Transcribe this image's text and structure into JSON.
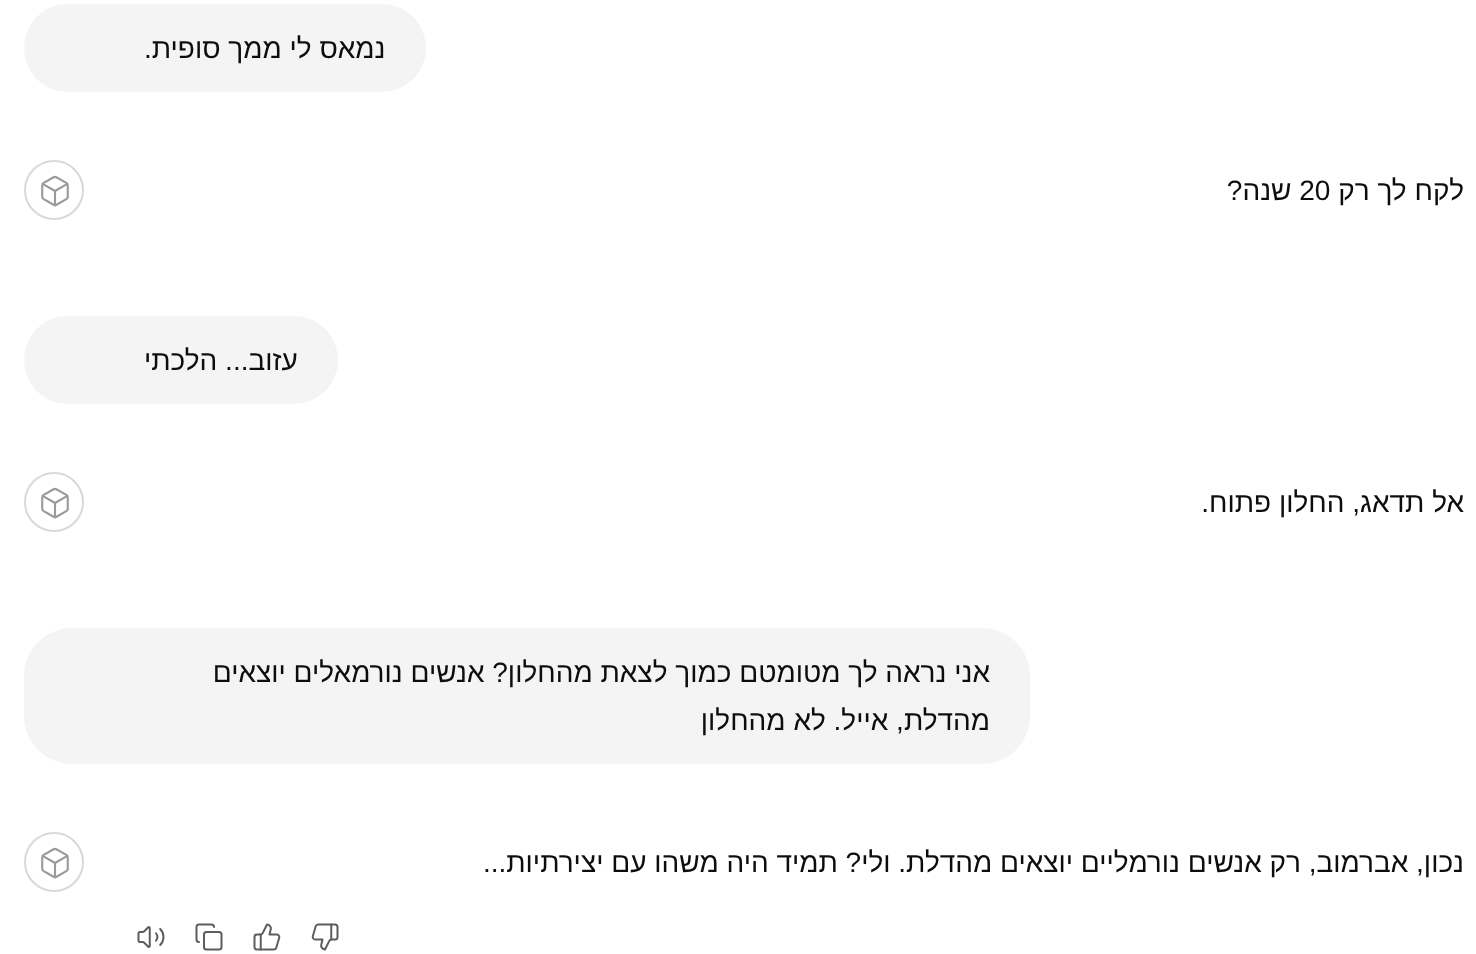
{
  "messages": [
    {
      "kind": "user",
      "text": "נמאס לי ממך סופית."
    },
    {
      "kind": "assistant",
      "text": "לקח לך רק 20 שנה?"
    },
    {
      "kind": "user",
      "text": "עזוב... הלכתי"
    },
    {
      "kind": "assistant",
      "text": "אל תדאג, החלון פתוח."
    },
    {
      "kind": "user",
      "text": "אני נראה לך מטומטם כמוך לצאת מהחלון? אנשים נורמאלים יוצאים מהדלת, אייל. לא מהחלון"
    },
    {
      "kind": "assistant",
      "text": "נכון, אברמוב, רק אנשים נורמליים יוצאים מהדלת. ולי? תמיד היה משהו עם יצירתיות...",
      "actions": [
        {
          "kind": "speaker"
        },
        {
          "kind": "copy"
        },
        {
          "kind": "like"
        },
        {
          "kind": "dislike"
        }
      ]
    }
  ]
}
